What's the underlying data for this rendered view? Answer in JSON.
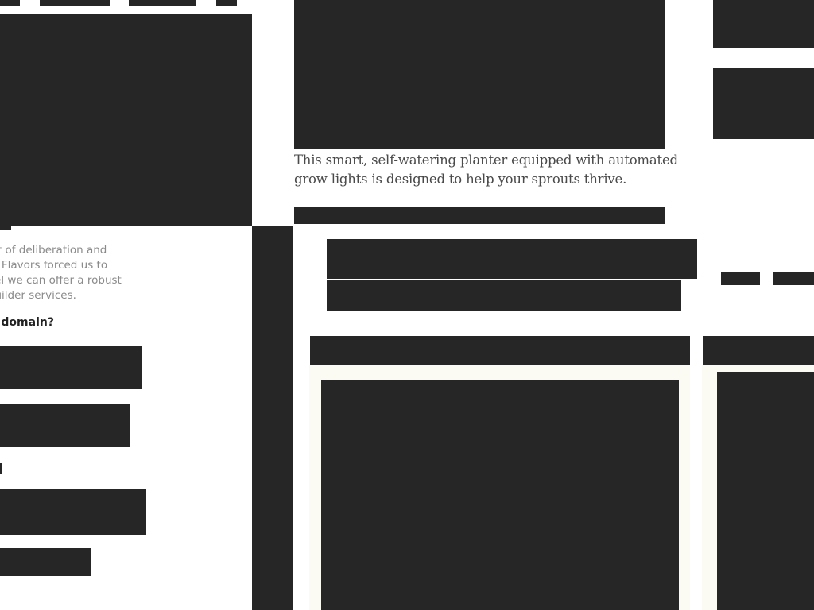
{
  "left_panel": {
    "blurb_lines": [
      "ent of deliberation and",
      "ith Flavors forced us to",
      "feel we can offer a robust",
      "-builder services."
    ],
    "question_text": "or domain?"
  },
  "product": {
    "description_lines": [
      "This smart, self-watering planter equipped with automated",
      "grow lights is designed to help your sprouts thrive."
    ]
  },
  "colors": {
    "redaction": "#262626",
    "card_background": "#fbfbf3",
    "page_background": "#ffffff",
    "body_text": "#4a4a4a",
    "muted_text": "#8a8a8a"
  }
}
